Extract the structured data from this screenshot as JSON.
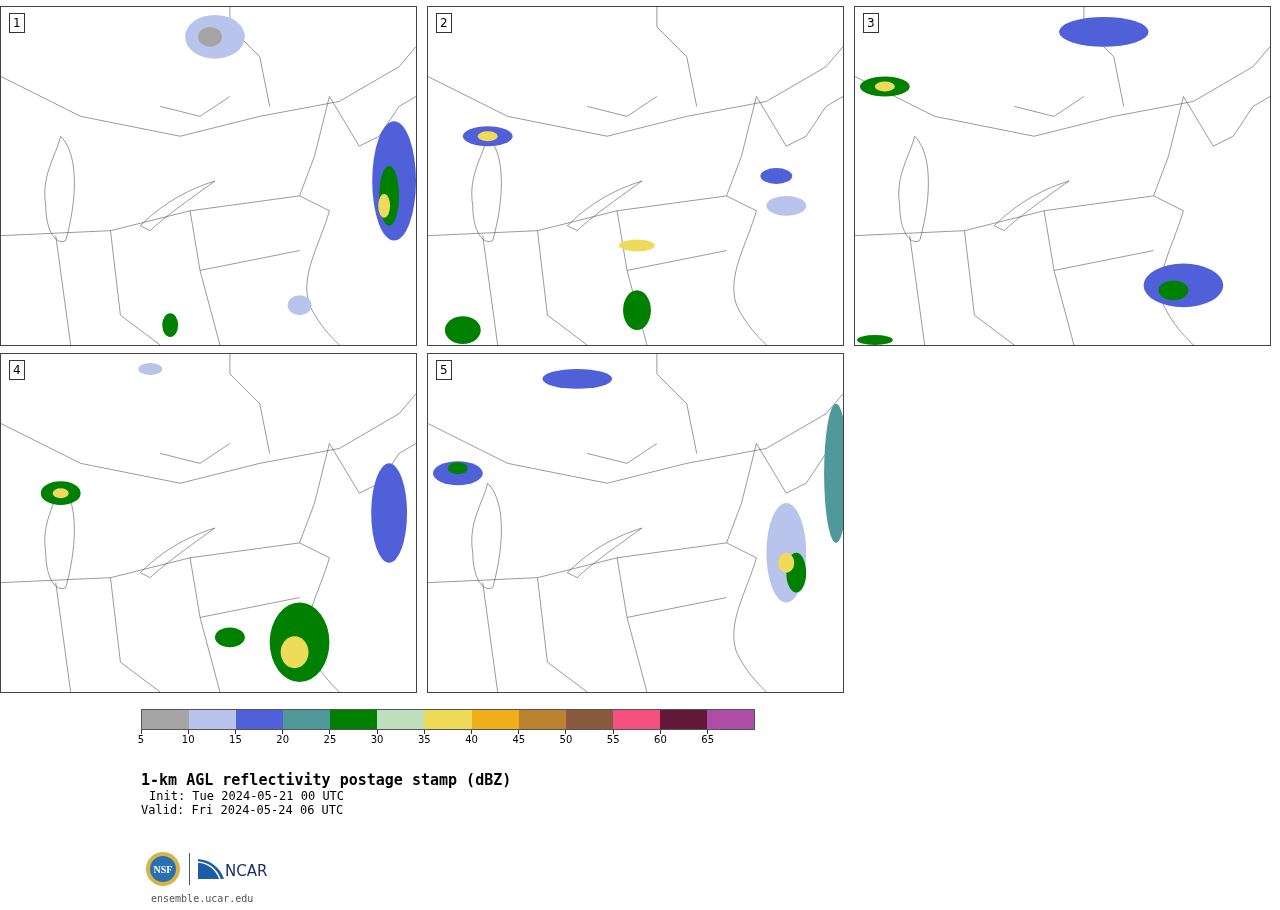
{
  "panels": [
    {
      "label": "1"
    },
    {
      "label": "2"
    },
    {
      "label": "3"
    },
    {
      "label": "4"
    },
    {
      "label": "5"
    }
  ],
  "colorbar": {
    "bins": [
      {
        "color": "#a5a5a5"
      },
      {
        "color": "#b8c4ec"
      },
      {
        "color": "#5060d8"
      },
      {
        "color": "#50999b"
      },
      {
        "color": "#008000"
      },
      {
        "color": "#bfdfbf"
      },
      {
        "color": "#efdb5a"
      },
      {
        "color": "#f0ae1a"
      },
      {
        "color": "#bb832f"
      },
      {
        "color": "#8a5a3f"
      },
      {
        "color": "#f45180"
      },
      {
        "color": "#631838"
      },
      {
        "color": "#ad4da5"
      }
    ],
    "ticks": [
      "5",
      "10",
      "15",
      "20",
      "25",
      "30",
      "35",
      "40",
      "45",
      "50",
      "55",
      "60",
      "65"
    ]
  },
  "title": "1-km AGL reflectivity postage stamp (dBZ)",
  "init": "Init: Tue 2024-05-21 00 UTC",
  "valid": "Valid: Fri 2024-05-24 06 UTC",
  "logo": {
    "left": "NSF",
    "right": "NCAR"
  },
  "url": "ensemble.ucar.edu"
}
